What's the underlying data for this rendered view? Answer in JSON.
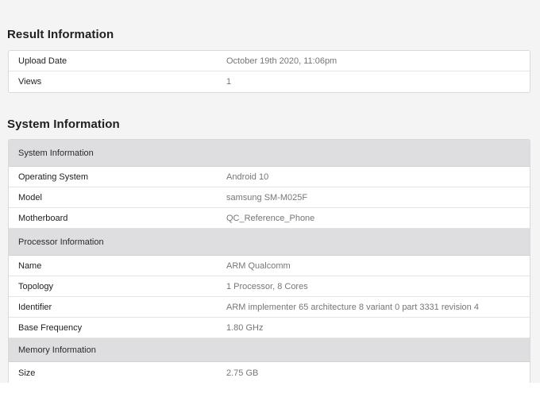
{
  "result": {
    "title": "Result Information",
    "rows": [
      {
        "label": "Upload Date",
        "value": "October 19th 2020, 11:06pm"
      },
      {
        "label": "Views",
        "value": "1"
      }
    ]
  },
  "system": {
    "title": "System Information",
    "groups": [
      {
        "header": "System Information",
        "rows": [
          {
            "label": "Operating System",
            "value": "Android 10"
          },
          {
            "label": "Model",
            "value": "samsung SM-M025F"
          },
          {
            "label": "Motherboard",
            "value": "QC_Reference_Phone"
          }
        ]
      },
      {
        "header": "Processor Information",
        "rows": [
          {
            "label": "Name",
            "value": "ARM Qualcomm"
          },
          {
            "label": "Topology",
            "value": "1 Processor, 8 Cores"
          },
          {
            "label": "Identifier",
            "value": "ARM implementer 65 architecture 8 variant 0 part 3331 revision 4"
          },
          {
            "label": "Base Frequency",
            "value": "1.80 GHz"
          }
        ]
      },
      {
        "header": "Memory Information",
        "rows": [
          {
            "label": "Size",
            "value": "2.75 GB"
          }
        ]
      }
    ]
  },
  "colors": {
    "page_background": "#f4f4f5",
    "group_header_background": "#dedee1",
    "value_text": "#767676"
  }
}
